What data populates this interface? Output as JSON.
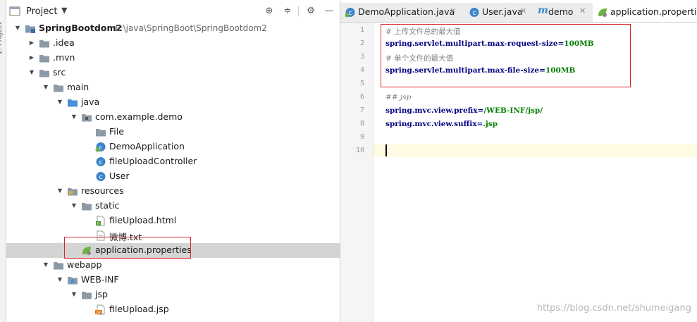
{
  "sidebar": {
    "tool_window_label": "1: Project"
  },
  "project_panel": {
    "title": "Project",
    "tree": [
      {
        "label": "SpringBootdom2",
        "path": "E:\\java\\SpringBoot\\SpringBootdom2",
        "icon": "module-folder-icon",
        "arrow": "▾",
        "bold": true
      },
      {
        "label": ".idea",
        "icon": "folder-icon",
        "arrow": "▸"
      },
      {
        "label": ".mvn",
        "icon": "folder-icon",
        "arrow": "▸"
      },
      {
        "label": "src",
        "icon": "folder-icon",
        "arrow": "▾"
      },
      {
        "label": "main",
        "icon": "folder-icon",
        "arrow": "▾"
      },
      {
        "label": "java",
        "icon": "source-folder-icon",
        "arrow": "▾"
      },
      {
        "label": "com.example.demo",
        "icon": "package-icon",
        "arrow": "▾"
      },
      {
        "label": "File",
        "icon": "folder-icon"
      },
      {
        "label": "DemoApplication",
        "icon": "spring-boot-class-icon"
      },
      {
        "label": "fileUploadController",
        "icon": "class-icon"
      },
      {
        "label": "User",
        "icon": "class-icon"
      },
      {
        "label": "resources",
        "icon": "resources-folder-icon",
        "arrow": "▾"
      },
      {
        "label": "static",
        "icon": "folder-icon",
        "arrow": "▾"
      },
      {
        "label": "fileUpload.html",
        "icon": "html-file-icon"
      },
      {
        "label": "微博.txt",
        "icon": "text-file-icon"
      },
      {
        "label": "application.properties",
        "icon": "spring-properties-icon",
        "selected": true
      },
      {
        "label": "webapp",
        "icon": "folder-icon",
        "arrow": "▾"
      },
      {
        "label": "WEB-INF",
        "icon": "web-folder-icon",
        "arrow": "▾"
      },
      {
        "label": "jsp",
        "icon": "folder-icon",
        "arrow": "▾"
      },
      {
        "label": "fileUpload.jsp",
        "icon": "jsp-file-icon"
      }
    ]
  },
  "editor": {
    "tabs": [
      {
        "label": "DemoApplication.java",
        "icon": "spring-boot-class-icon"
      },
      {
        "label": "User.java",
        "icon": "class-icon"
      },
      {
        "label": "demo",
        "icon": "maven-icon",
        "italic_m": "m"
      },
      {
        "label": "application.properties",
        "icon": "spring-properties-icon",
        "active": true
      }
    ],
    "line_numbers": [
      "1",
      "2",
      "3",
      "4",
      "5",
      "6",
      "7",
      "8",
      "9",
      "10"
    ],
    "lines": [
      {
        "comment": "# 上传文件总的最大值"
      },
      {
        "key": "spring.servlet.multipart.max-request-size",
        "eq": "=",
        "value": "100MB"
      },
      {
        "comment": "# 单个文件的最大值"
      },
      {
        "key": "spring.servlet.multipart.max-file-size",
        "eq": "=",
        "value": "100MB"
      },
      {},
      {
        "comment": "## jsp",
        "italic": true
      },
      {
        "key": "spring.mvc.view.prefix",
        "eq": "=",
        "value": "/WEB-INF/jsp/"
      },
      {
        "key": "spring.mvc.view.suffix",
        "eq": "=",
        "value": ".jsp"
      },
      {},
      {}
    ]
  },
  "watermark": "https://blog.csdn.net/shumeigang",
  "colors": {
    "highlight_box": "#d9252b",
    "selection": "#d4d4d4",
    "caret_line": "#fffbe3",
    "property_key": "#000080",
    "property_value": "#008000",
    "comment": "#808080"
  }
}
